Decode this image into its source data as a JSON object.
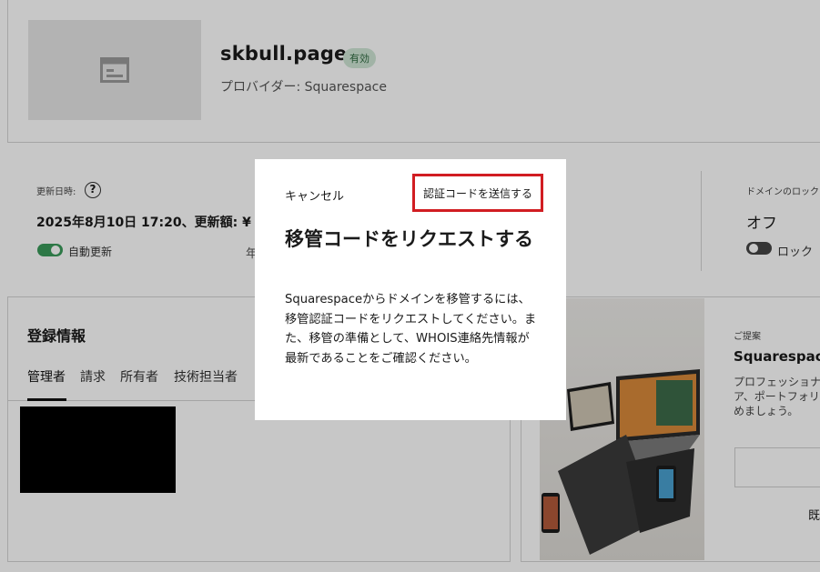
{
  "domain": {
    "name": "skbull.page",
    "status_badge": "有効",
    "provider": "プロバイダー: Squarespace"
  },
  "renewal": {
    "label": "更新日時:",
    "help_icon": "question-circle-icon",
    "value_line": "2025年8月10日 17:20、更新額: ¥",
    "auto_renew_label": "自動更新",
    "auto_renew_on": true,
    "partial_text": "年"
  },
  "lock": {
    "label": "ドメインのロック",
    "value": "オフ",
    "toggle_label": "ロック",
    "locked": false
  },
  "registration": {
    "title": "登録情報",
    "tabs": [
      "管理者",
      "請求",
      "所有者",
      "技術担当者"
    ],
    "active_tab": 0
  },
  "suggestion": {
    "eyebrow": "ご提案",
    "title": "Squarespace",
    "description_lines": [
      "プロフェッショナ",
      "ア、ポートフォリ",
      "めましょう。"
    ],
    "bottom_text": "既"
  },
  "dialog": {
    "cancel_label": "キャンセル",
    "send_label": "認証コードを送信する",
    "title": "移管コードをリクエストする",
    "body": "Squarespaceからドメインを移管するには、移管認証コードをリクエストしてください。また、移管の準備として、WHOIS連絡先情報が最新であることをご確認ください。"
  },
  "colors": {
    "highlight_border": "#d11d22",
    "badge_bg": "#cfe6d5",
    "toggle_on": "#3a9a5a",
    "toggle_off": "#444444"
  }
}
